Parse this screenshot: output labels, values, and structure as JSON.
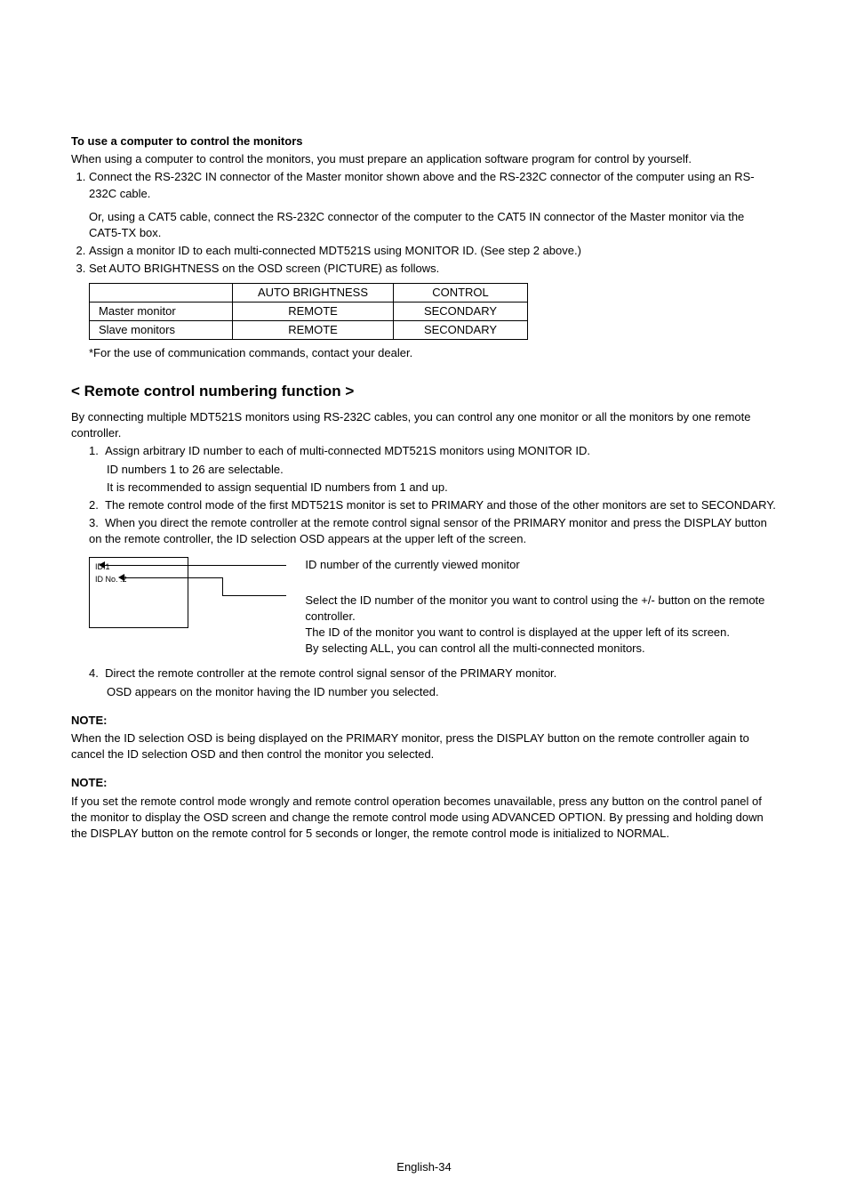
{
  "section1": {
    "heading": "To use a computer to control the monitors",
    "intro": "When using a computer to control the monitors, you must prepare an application software program for control by yourself.",
    "steps": [
      "Connect the RS-232C IN connector of the Master monitor shown above and the RS-232C connector of the computer using an RS-232C cable.",
      "Or, using a CAT5 cable, connect the RS-232C connector of the computer to the CAT5 IN connector of the Master monitor via the CAT5-TX box.",
      "Assign a monitor ID to each multi-connected MDT521S using MONITOR ID. (See step 2 above.)",
      "Set AUTO BRIGHTNESS on the OSD screen (PICTURE) as follows."
    ],
    "table": {
      "headers": [
        "",
        "AUTO BRIGHTNESS",
        "CONTROL"
      ],
      "rows": [
        [
          "Master monitor",
          "REMOTE",
          "SECONDARY"
        ],
        [
          "Slave monitors",
          "REMOTE",
          "SECONDARY"
        ]
      ]
    },
    "footnote": "*For the use of communication commands, contact your dealer."
  },
  "section2": {
    "heading": "< Remote control numbering function >",
    "intro": "By connecting multiple MDT521S monitors using RS-232C cables, you can control any one monitor or all the monitors by one remote controller.",
    "steps": {
      "s1": "Assign arbitrary ID number to each of multi-connected MDT521S monitors using MONITOR ID.",
      "s1b": "ID numbers 1 to 26 are selectable.",
      "s1c": "It is recommended to assign sequential ID numbers from 1 and up.",
      "s2": "The remote control mode of the first MDT521S monitor is set to PRIMARY and those of the other monitors are set to SECONDARY.",
      "s3": "When you direct the remote controller at the remote control signal sensor of the PRIMARY monitor and press the DISPLAY button on the remote controller, the ID selection OSD appears at the upper left of the screen."
    },
    "diagram": {
      "id_current": "ID:1",
      "id_no": "ID No. :2",
      "caption1": "ID number of the currently viewed monitor",
      "caption2": "Select the ID number of the monitor you want to control using the +/- button on the remote controller.",
      "caption2b": "The ID of the monitor you want to control is displayed at the upper left of its screen.",
      "caption2c": "By selecting ALL, you can control all the multi-connected monitors."
    },
    "post": {
      "s4a": "Direct the remote controller at the remote control signal sensor of the PRIMARY monitor.",
      "s4b": "OSD appears on the monitor having the ID number you selected."
    },
    "note1_label": "NOTE:",
    "note1": "When the ID selection OSD is being displayed on the PRIMARY monitor, press the DISPLAY button on the remote controller again to cancel the ID selection OSD and then control the monitor you selected.",
    "note2_label": "NOTE:",
    "note2": "If you set the remote control mode wrongly and remote control operation becomes unavailable, press any button on the control panel of the monitor to display the OSD screen and change the remote control mode using ADVANCED OPTION. By pressing and holding down the DISPLAY button on the remote control for 5 seconds or longer, the remote control mode is initialized to NORMAL."
  },
  "footer": "English-34"
}
